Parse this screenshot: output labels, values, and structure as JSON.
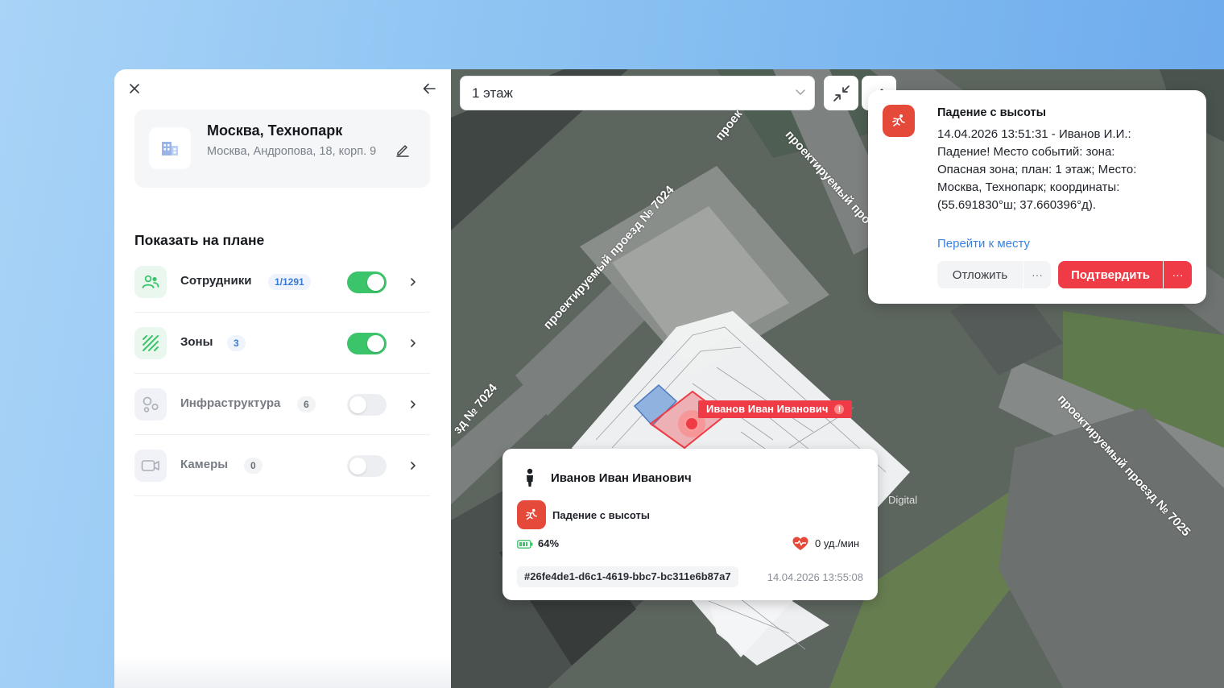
{
  "sidebar": {
    "site": {
      "title": "Москва, Технопарк",
      "address": "Москва, Андропова, 18, корп. 9"
    },
    "section_title": "Показать на плане",
    "layers": [
      {
        "label": "Сотрудники",
        "count": "1/1291",
        "enabled": true
      },
      {
        "label": "Зоны",
        "count": "3",
        "enabled": true
      },
      {
        "label": "Инфраструктура",
        "count": "6",
        "enabled": false
      },
      {
        "label": "Камеры",
        "count": "0",
        "enabled": false
      }
    ]
  },
  "map": {
    "floor_select": {
      "value": "1 этаж"
    },
    "road_labels": [
      "проектируемый проезд № 7024",
      "зд № 7024",
      "проектируемый про",
      "проек",
      "проектируемый проезд № 7025"
    ],
    "worker_tag": "Иванов Иван Иванович",
    "worker_alert_mark": "!",
    "watermark": "Digital"
  },
  "alert": {
    "title": "Падение с высоты",
    "text": "14.04.2026 13:51:31 - Иванов И.И.: Падение! Место событий: зона: Опасная зона; план: 1 этаж; Место: Москва, Технопарк; координаты: (55.691830°ш; 37.660396°д).",
    "link": "Перейти к месту",
    "postpone_label": "Отложить",
    "confirm_label": "Подтвердить",
    "more_label": "···"
  },
  "person_card": {
    "name": "Иванов Иван Иванович",
    "event": "Падение с высоты",
    "battery": "64%",
    "heart_rate": "0 уд./мин",
    "device_id": "#26fe4de1-d6c1-4619-bbc7-bc311e6b87a7",
    "timestamp": "14.04.2026 13:55:08"
  },
  "colors": {
    "accent_green": "#3cc46b",
    "alert_red": "#ef3b45",
    "event_icon_red": "#e5493a",
    "link_blue": "#3a82e0"
  }
}
